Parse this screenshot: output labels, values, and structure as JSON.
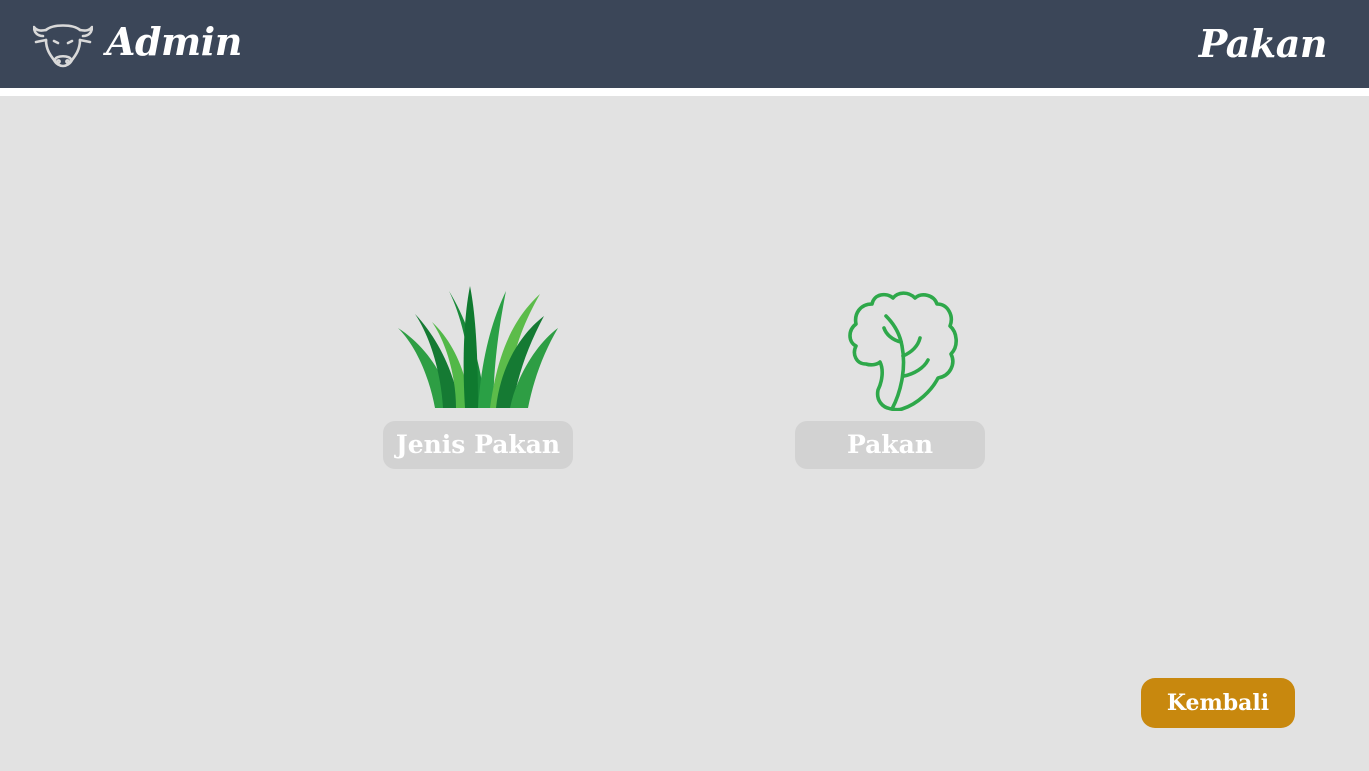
{
  "header": {
    "logo_icon": "cow-head-icon",
    "app_title": "Admin",
    "page_title": "Pakan",
    "background_color": "#3b4658"
  },
  "menu": {
    "items": [
      {
        "label": "Jenis Pakan",
        "icon": "grass-icon"
      },
      {
        "label": "Pakan",
        "icon": "lettuce-icon"
      }
    ]
  },
  "footer": {
    "back_label": "Kembali",
    "back_color": "#c8880e"
  }
}
